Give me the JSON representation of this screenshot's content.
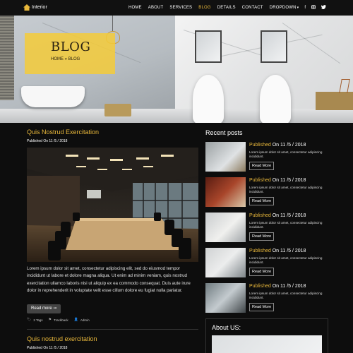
{
  "nav": {
    "logo_text": "Interior",
    "items": [
      {
        "label": "HOME"
      },
      {
        "label": "ABOUT"
      },
      {
        "label": "SERVICES"
      },
      {
        "label": "BLOG"
      },
      {
        "label": "DETAILS"
      },
      {
        "label": "CONTACT"
      },
      {
        "label": "DROPDOWN"
      }
    ],
    "active": "BLOG",
    "social_icons": [
      "facebook-icon",
      "instagram-icon",
      "twitter-icon"
    ]
  },
  "banner": {
    "title": "BLOG",
    "breadcrumb": "HOME » BLOG"
  },
  "posts": [
    {
      "title": "Quis Nostrud Exercitation",
      "meta": "Published On 11 /5 / 2018",
      "excerpt": "Lorem ipsum dolor sit amet, consectetur adipiscing elit, sed do eiusmod tempor incididunt ut labore et dolore magna aliqua. Ut enim ad minim veniam, quis nostrud exercitation ullamco laboris nisi ut aliquip ex ea commodo consequat. Duis aute irure dolor in reprehenderit in voluptate velit esse cillum dolore eu fugiat nulla pariatur.",
      "read_more": "Read more ➞",
      "tags": "2 Tags",
      "trackback": "Trackback",
      "author": "Admin"
    },
    {
      "title": "Quis nostrud exercitation",
      "meta": "Published On 11 /5 / 2018"
    }
  ],
  "sidebar": {
    "recent_title": "Recent posts",
    "recent_posts": [
      {
        "published": "Published",
        "date": "On 11 /5 / 2018",
        "desc": "Lorem ipsum dolor sit amet, consectetur adipiscing incididunt.",
        "button": "Read More"
      },
      {
        "published": "Published",
        "date": "On 11 /5 / 2018",
        "desc": "Lorem ipsum dolor sit amet, consectetur adipiscing incididunt.",
        "button": "Read More"
      },
      {
        "published": "Published",
        "date": "On 11 /5 / 2018",
        "desc": "Lorem ipsum dolor sit amet, consectetur adipiscing incididunt.",
        "button": "Read More"
      },
      {
        "published": "Published",
        "date": "On 11 /5 / 2018",
        "desc": "Lorem ipsum dolor sit amet, consectetur adipiscing incididunt.",
        "button": "Read More"
      },
      {
        "published": "Published",
        "date": "On 11 /5 / 2018",
        "desc": "Lorem ipsum dolor sit amet, consectetur adipiscing incididunt.",
        "button": "Read More"
      }
    ],
    "about_title": "About US:"
  },
  "colors": {
    "accent": "#e9b83b",
    "background": "#0d0d0d",
    "banner": "#f5cb38"
  }
}
